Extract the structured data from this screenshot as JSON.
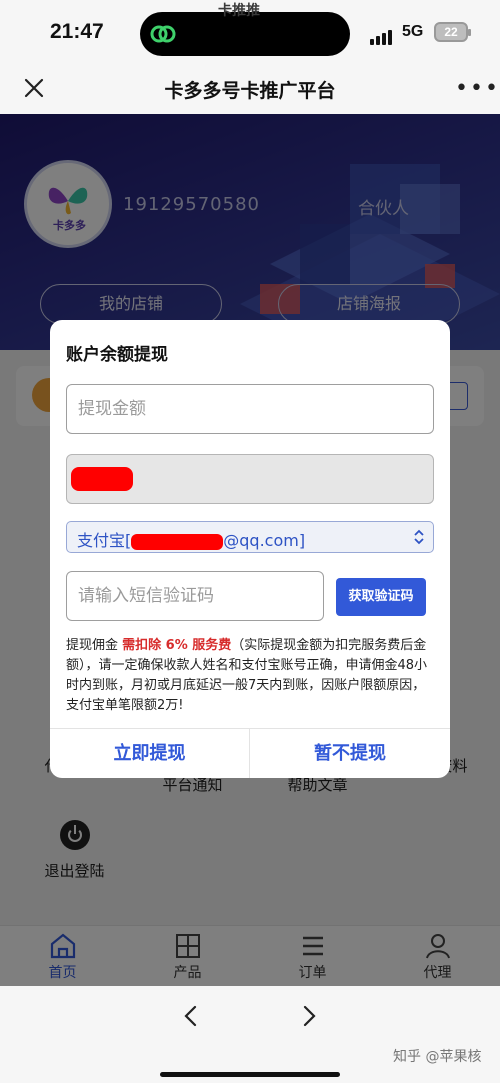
{
  "status_bar": {
    "time": "21:47",
    "network": "5G",
    "battery": "22",
    "island_ghost_text": "卡推推"
  },
  "nav": {
    "title": "卡多多号卡推广平台",
    "close_icon": "close-icon",
    "more_icon": "more-dots-icon",
    "more_glyph": "•••"
  },
  "hero": {
    "avatar_text": "卡多多",
    "phone": "19129570580",
    "role": "合伙人",
    "my_shop_label": "我的店铺",
    "shop_poster_label": "店铺海报"
  },
  "grid": {
    "items": [
      {
        "label": "代理排行",
        "icon": "ranking-icon"
      },
      {
        "label": "平台通知",
        "icon": "speaker-icon"
      },
      {
        "label": "帮助文章",
        "icon": "article-icon"
      },
      {
        "label": "产品资料",
        "icon": "document-icon"
      },
      {
        "label": "退出登陆",
        "icon": "power-icon"
      }
    ]
  },
  "tabbar": {
    "tabs": [
      {
        "label": "首页",
        "icon": "home-icon",
        "active": true
      },
      {
        "label": "产品",
        "icon": "grid-icon",
        "active": false
      },
      {
        "label": "订单",
        "icon": "list-icon",
        "active": false
      },
      {
        "label": "代理",
        "icon": "agent-icon",
        "active": false
      }
    ]
  },
  "dialog": {
    "title": "账户余额提现",
    "amount_placeholder": "提现金额",
    "account_prefix": "支付宝[",
    "account_suffix": "@qq.com]",
    "code_placeholder": "请输入短信验证码",
    "get_code_label": "获取验证码",
    "notice_part1": "提现佣金 ",
    "notice_highlight": "需扣除 6% 服务费",
    "notice_part2": "（实际提现金额为扣完服务费后金额），请一定确保收款人姓名和支付宝账号正确，申请佣金48小时内到账，月初或月底延迟一般7天内到账，因账户限额原因，支付宝单笔限额2万!",
    "confirm_label": "立即提现",
    "cancel_label": "暂不提现"
  },
  "colors": {
    "accent": "#3259d8",
    "warning": "#d72c2c",
    "hero_bg": "#2d2f8a",
    "redaction": "#ff0000"
  },
  "browser": {
    "back_icon": "chevron-left-icon",
    "forward_icon": "chevron-right-icon",
    "watermark": "知乎 @苹果核"
  }
}
